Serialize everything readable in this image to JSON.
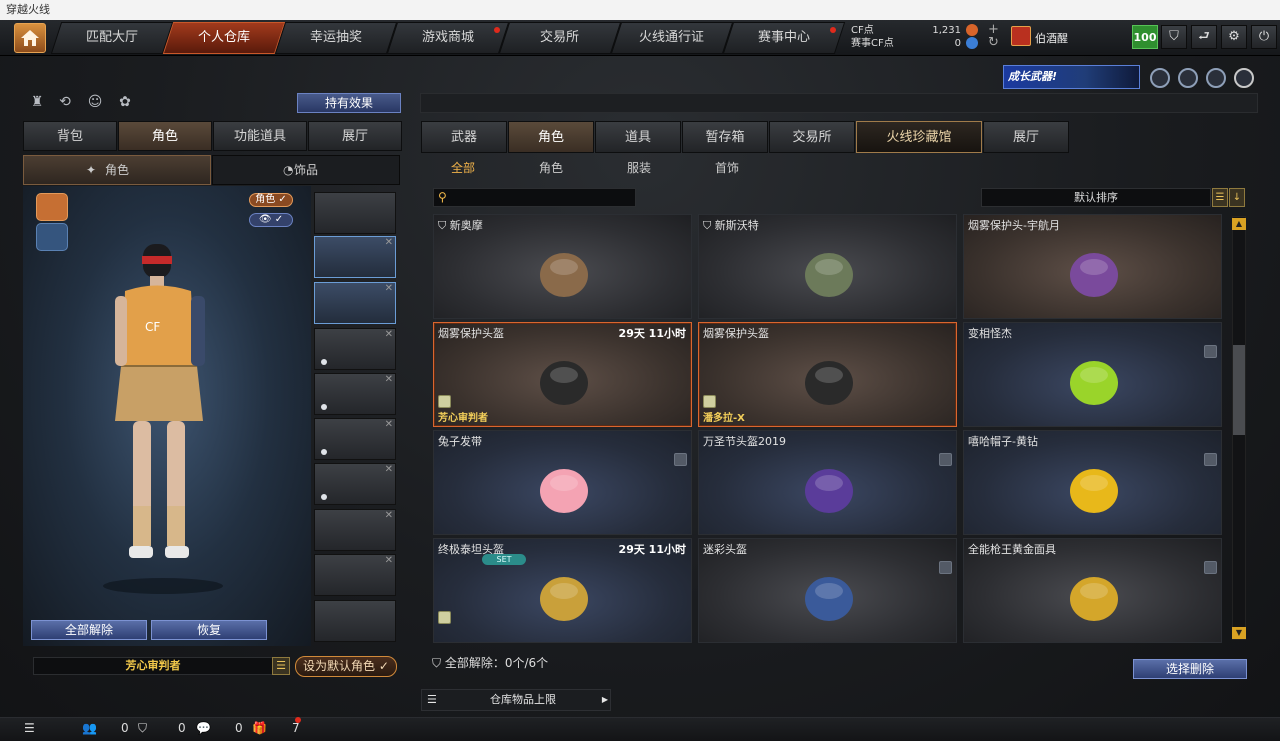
{
  "window": {
    "title": "穿越火线"
  },
  "nav": {
    "tabs": [
      {
        "label": "匹配大厅",
        "active": false,
        "dot": false
      },
      {
        "label": "个人仓库",
        "active": true,
        "dot": false
      },
      {
        "label": "幸运抽奖",
        "active": false,
        "dot": false
      },
      {
        "label": "游戏商城",
        "active": false,
        "dot": true
      },
      {
        "label": "交易所",
        "active": false,
        "dot": false
      },
      {
        "label": "火线通行证",
        "active": false,
        "dot": false
      },
      {
        "label": "赛事中心",
        "active": false,
        "dot": true
      }
    ]
  },
  "currency": {
    "cf_label": "CF点",
    "cf_value": "1,231",
    "match_label": "赛事CF点",
    "match_value": "0"
  },
  "user": {
    "name": "伯酒醒",
    "level": "100"
  },
  "promo": {
    "label": "成长武器!"
  },
  "left": {
    "hold_effect": "持有效果",
    "tabs": [
      "背包",
      "角色",
      "功能道具",
      "展厅"
    ],
    "active_tab": 1,
    "subtabs": [
      "角色",
      "饰品"
    ],
    "chip_role": "角色",
    "clear_all": "全部解除",
    "restore": "恢复",
    "character_name": "芳心审判者",
    "set_default": "设为默认角色"
  },
  "right": {
    "tabs": [
      "武器",
      "角色",
      "道具",
      "暂存箱",
      "交易所",
      "火线珍藏馆",
      "展厅"
    ],
    "active_tab": 1,
    "highlight_tab": 5,
    "subtabs": [
      "全部",
      "角色",
      "服装",
      "首饰"
    ],
    "active_subtab": 0,
    "sort_label": "默认排序",
    "items": [
      {
        "title": "新奥摩",
        "time": "",
        "owner": "",
        "style": "dark",
        "set": "",
        "trash": false,
        "bookmark": true,
        "sel": false
      },
      {
        "title": "新斯沃特",
        "time": "",
        "owner": "",
        "style": "dark",
        "set": "",
        "trash": false,
        "bookmark": true,
        "sel": false
      },
      {
        "title": "烟雾保护头-宇航月",
        "time": "",
        "owner": "",
        "style": "brown",
        "set": "",
        "trash": false,
        "bookmark": false,
        "sel": false
      },
      {
        "title": "烟雾保护头盔",
        "time": "29天 11小时",
        "owner": "芳心审判者",
        "style": "brown",
        "set": "",
        "trash": false,
        "bookmark": false,
        "sel": true
      },
      {
        "title": "烟雾保护头盔",
        "time": "",
        "owner": "潘多拉-X",
        "style": "brown",
        "set": "",
        "trash": false,
        "bookmark": false,
        "sel": true
      },
      {
        "title": "变相怪杰",
        "time": "",
        "owner": "",
        "style": "blue",
        "set": "",
        "trash": true,
        "bookmark": false,
        "sel": false
      },
      {
        "title": "兔子发带",
        "time": "",
        "owner": "",
        "style": "blue",
        "set": "",
        "trash": true,
        "bookmark": false,
        "sel": false
      },
      {
        "title": "万圣节头盔2019",
        "time": "",
        "owner": "",
        "style": "blue",
        "set": "",
        "trash": true,
        "bookmark": false,
        "sel": false
      },
      {
        "title": "嘻哈帽子-黄钻",
        "time": "",
        "owner": "",
        "style": "blue",
        "set": "",
        "trash": true,
        "bookmark": false,
        "sel": false
      },
      {
        "title": "终极泰坦头盔",
        "time": "29天 11小时",
        "owner": "",
        "style": "blue",
        "set": "SET",
        "trash": false,
        "bookmark": false,
        "sel": false
      },
      {
        "title": "迷彩头盔",
        "time": "",
        "owner": "",
        "style": "dark",
        "set": "",
        "trash": true,
        "bookmark": false,
        "sel": false
      },
      {
        "title": "全能枪王黄金面具",
        "time": "",
        "owner": "",
        "style": "dark",
        "set": "",
        "trash": true,
        "bookmark": false,
        "sel": false
      }
    ],
    "footer": "全部解除：0个/6个",
    "select_delete": "选择删除",
    "stock_limit": "仓库物品上限"
  },
  "bottom": {
    "count_a": "0",
    "count_b": "0",
    "count_c": "0",
    "count_d": "7"
  }
}
